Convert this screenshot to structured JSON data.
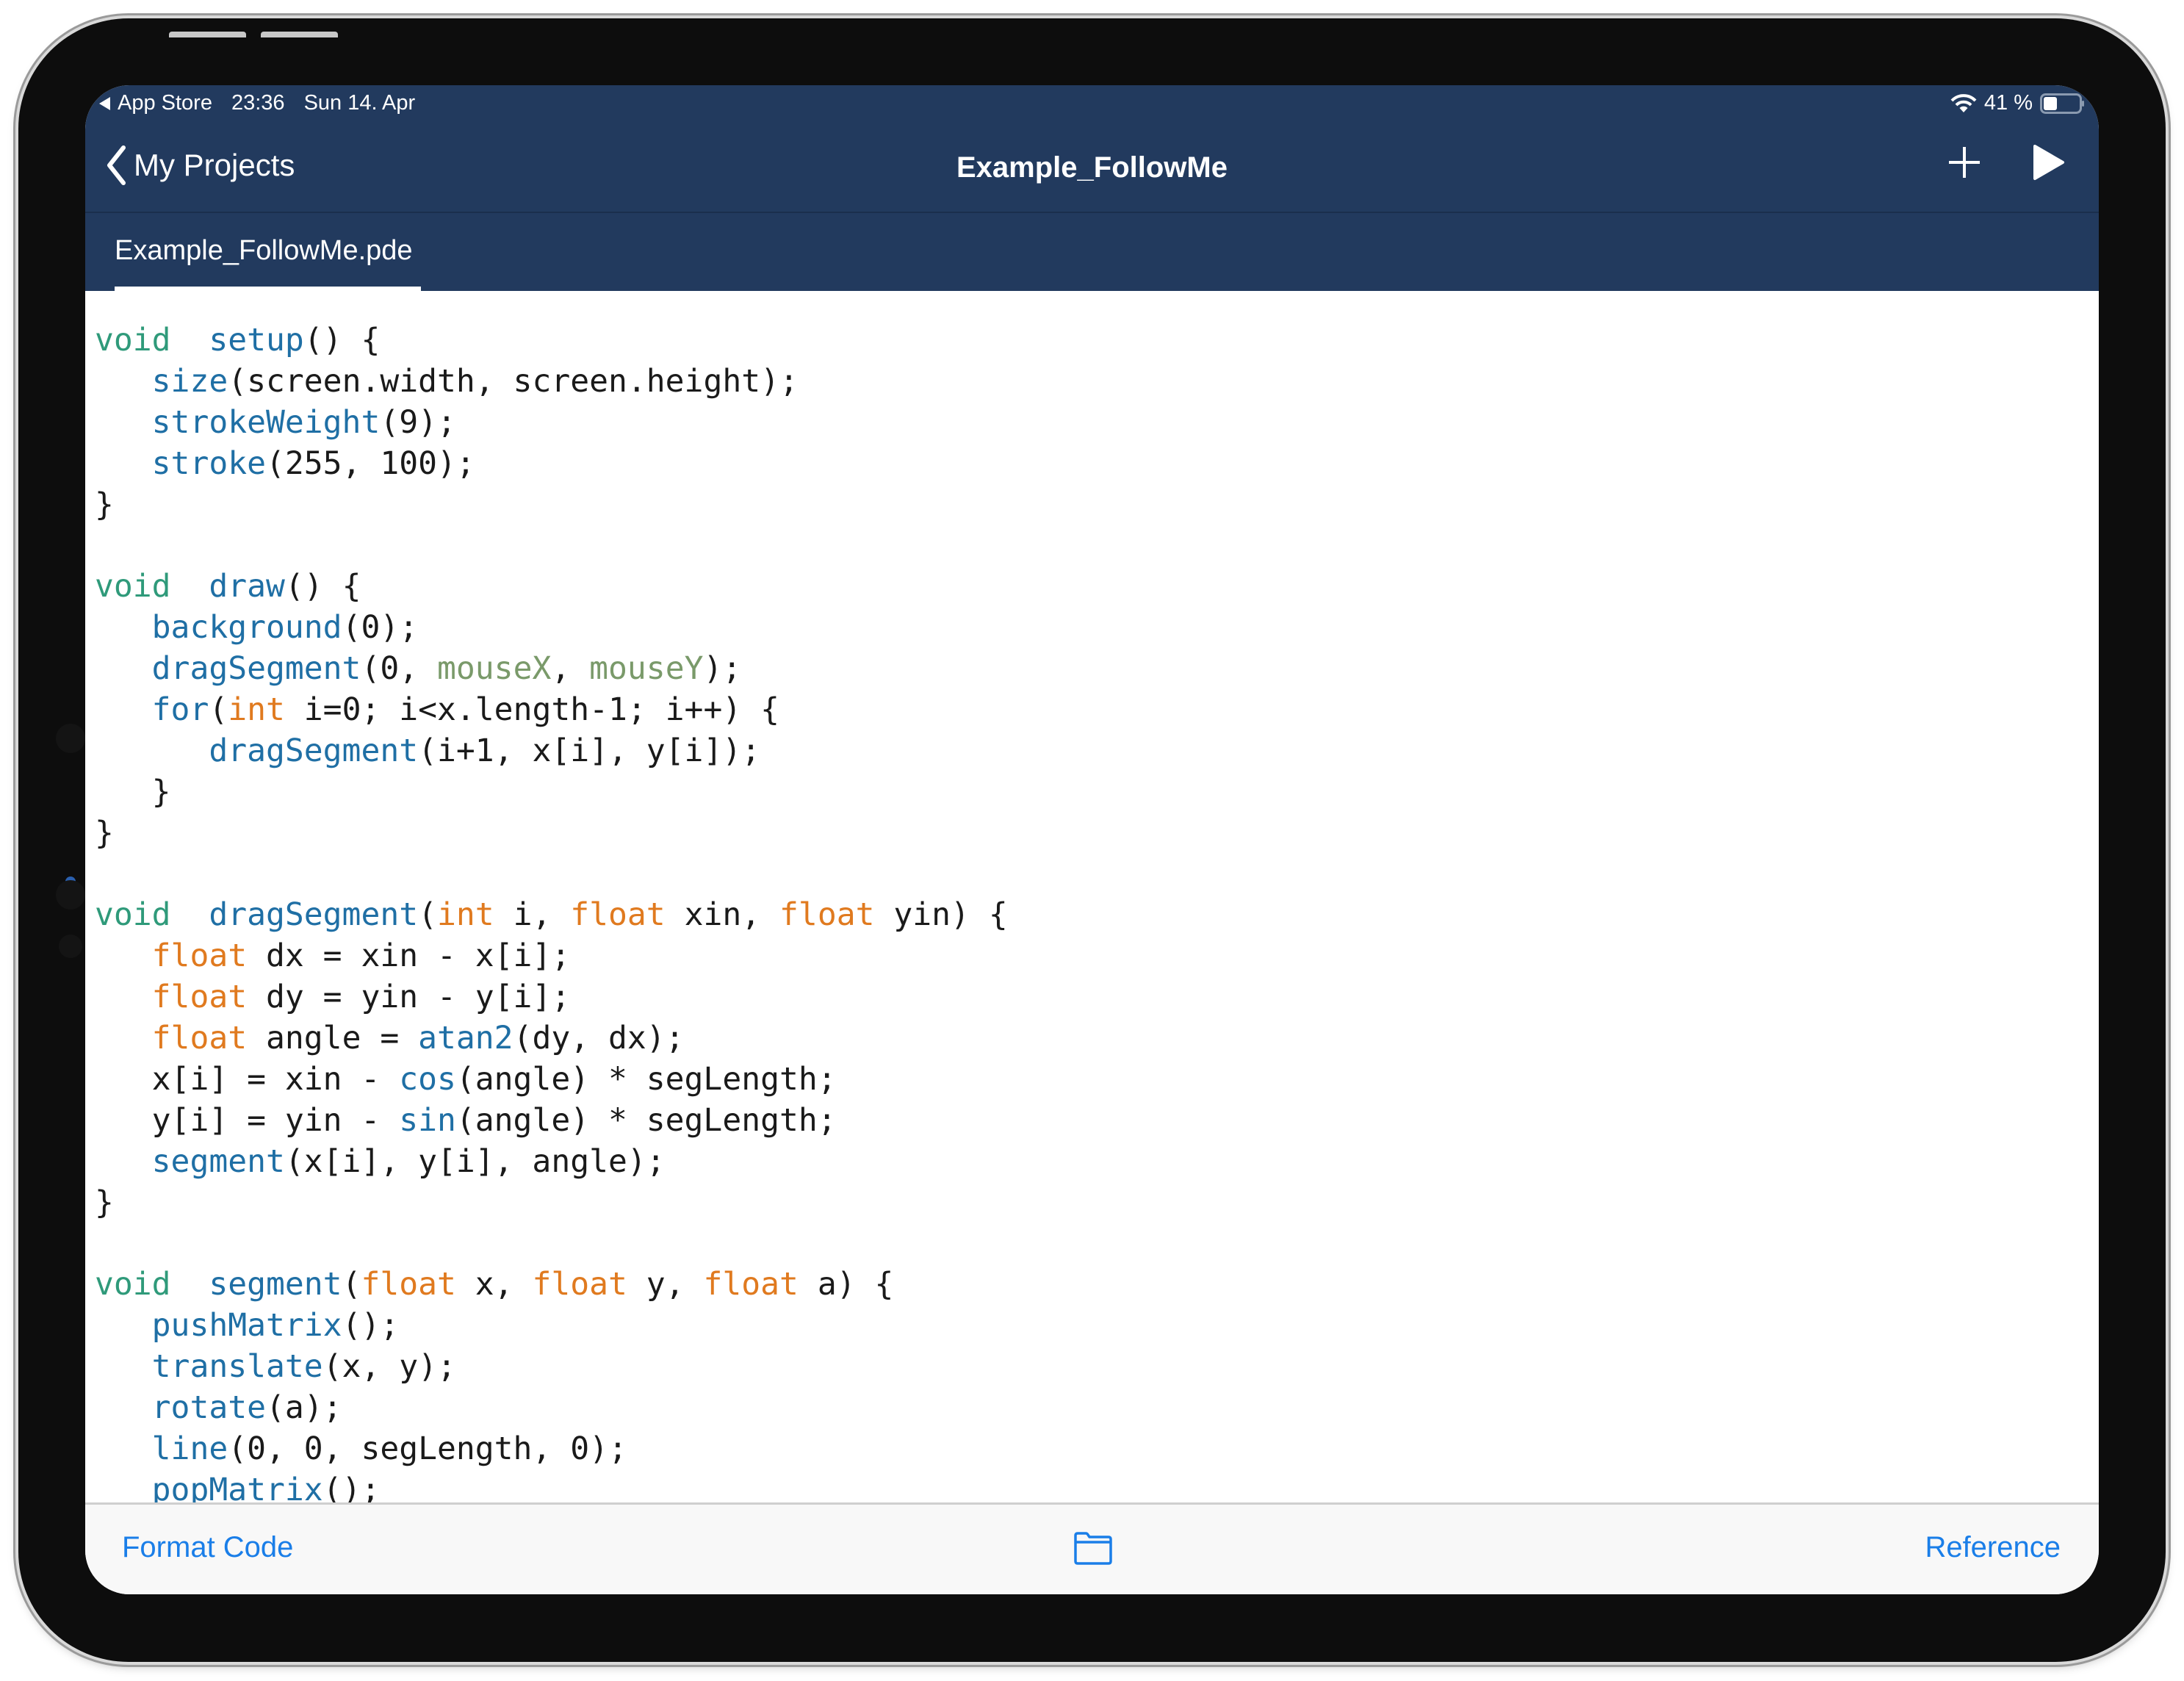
{
  "status_bar": {
    "back_app": "App Store",
    "time": "23:36",
    "date": "Sun 14. Apr",
    "battery": "41 %",
    "battery_level": 0.41,
    "icons": [
      "back-arrow-icon",
      "wifi-icon",
      "battery-icon"
    ]
  },
  "nav": {
    "back_label": "My Projects",
    "title": "Example_FollowMe",
    "actions": [
      "plus-icon",
      "play-icon"
    ]
  },
  "tabs": [
    {
      "label": "Example_FollowMe.pde",
      "active": true
    }
  ],
  "colors": {
    "nav_background": "#223a5e",
    "keyword": "#2f9a7a",
    "function": "#1f6fa5",
    "type": "#e07a1f",
    "builtin_variable": "#7a9a6a",
    "text": "#1a1a1a",
    "toolbar_accent": "#1a7ee8"
  },
  "code": {
    "language": "Processing",
    "lines": [
      [
        [
          "kw",
          "void"
        ],
        [
          "",
          "  "
        ],
        [
          "fn",
          "setup"
        ],
        [
          "",
          "() {"
        ]
      ],
      [
        [
          "",
          "   "
        ],
        [
          "fn",
          "size"
        ],
        [
          "",
          "(screen.width, screen.height);"
        ]
      ],
      [
        [
          "",
          "   "
        ],
        [
          "fn",
          "strokeWeight"
        ],
        [
          "",
          "(9);"
        ]
      ],
      [
        [
          "",
          "   "
        ],
        [
          "fn",
          "stroke"
        ],
        [
          "",
          "(255, 100);"
        ]
      ],
      [
        [
          "",
          "}"
        ]
      ],
      [
        [
          "",
          ""
        ]
      ],
      [
        [
          "kw",
          "void"
        ],
        [
          "",
          "  "
        ],
        [
          "fn",
          "draw"
        ],
        [
          "",
          "() {"
        ]
      ],
      [
        [
          "",
          "   "
        ],
        [
          "fn",
          "background"
        ],
        [
          "",
          "(0);"
        ]
      ],
      [
        [
          "",
          "   "
        ],
        [
          "fn",
          "dragSegment"
        ],
        [
          "",
          "(0, "
        ],
        [
          "var",
          "mouseX"
        ],
        [
          "",
          ", "
        ],
        [
          "var",
          "mouseY"
        ],
        [
          "",
          ");"
        ]
      ],
      [
        [
          "",
          "   "
        ],
        [
          "fn",
          "for"
        ],
        [
          "",
          "("
        ],
        [
          "ty",
          "int"
        ],
        [
          "",
          " i=0; i<x.length-1; i++) {"
        ]
      ],
      [
        [
          "",
          "      "
        ],
        [
          "fn",
          "dragSegment"
        ],
        [
          "",
          "(i+1, x[i], y[i]);"
        ]
      ],
      [
        [
          "",
          "   }"
        ]
      ],
      [
        [
          "",
          "}"
        ]
      ],
      [
        [
          "",
          ""
        ]
      ],
      [
        [
          "kw",
          "void"
        ],
        [
          "",
          "  "
        ],
        [
          "fn",
          "dragSegment"
        ],
        [
          "",
          "("
        ],
        [
          "ty",
          "int"
        ],
        [
          "",
          " i, "
        ],
        [
          "ty",
          "float"
        ],
        [
          "",
          " xin, "
        ],
        [
          "ty",
          "float"
        ],
        [
          "",
          " yin) {"
        ]
      ],
      [
        [
          "",
          "   "
        ],
        [
          "ty",
          "float"
        ],
        [
          "",
          " dx = xin - x[i];"
        ]
      ],
      [
        [
          "",
          "   "
        ],
        [
          "ty",
          "float"
        ],
        [
          "",
          " dy = yin - y[i];"
        ]
      ],
      [
        [
          "",
          "   "
        ],
        [
          "ty",
          "float"
        ],
        [
          "",
          " angle = "
        ],
        [
          "fn",
          "atan2"
        ],
        [
          "",
          "(dy, dx);"
        ]
      ],
      [
        [
          "",
          "   x[i] = xin - "
        ],
        [
          "fn",
          "cos"
        ],
        [
          "",
          "(angle) * segLength;"
        ]
      ],
      [
        [
          "",
          "   y[i] = yin - "
        ],
        [
          "fn",
          "sin"
        ],
        [
          "",
          "(angle) * segLength;"
        ]
      ],
      [
        [
          "",
          "   "
        ],
        [
          "fn",
          "segment"
        ],
        [
          "",
          "(x[i], y[i], angle);"
        ]
      ],
      [
        [
          "",
          "}"
        ]
      ],
      [
        [
          "",
          ""
        ]
      ],
      [
        [
          "kw",
          "void"
        ],
        [
          "",
          "  "
        ],
        [
          "fn",
          "segment"
        ],
        [
          "",
          "("
        ],
        [
          "ty",
          "float"
        ],
        [
          "",
          " x, "
        ],
        [
          "ty",
          "float"
        ],
        [
          "",
          " y, "
        ],
        [
          "ty",
          "float"
        ],
        [
          "",
          " a) {"
        ]
      ],
      [
        [
          "",
          "   "
        ],
        [
          "fn",
          "pushMatrix"
        ],
        [
          "",
          "();"
        ]
      ],
      [
        [
          "",
          "   "
        ],
        [
          "fn",
          "translate"
        ],
        [
          "",
          "(x, y);"
        ]
      ],
      [
        [
          "",
          "   "
        ],
        [
          "fn",
          "rotate"
        ],
        [
          "",
          "(a);"
        ]
      ],
      [
        [
          "",
          "   "
        ],
        [
          "fn",
          "line"
        ],
        [
          "",
          "(0, 0, segLength, 0);"
        ]
      ],
      [
        [
          "",
          "   "
        ],
        [
          "fn",
          "popMatrix"
        ],
        [
          "",
          "();"
        ]
      ]
    ]
  },
  "toolbar": {
    "format_label": "Format Code",
    "files_icon": "folder-icon",
    "reference_label": "Reference"
  }
}
